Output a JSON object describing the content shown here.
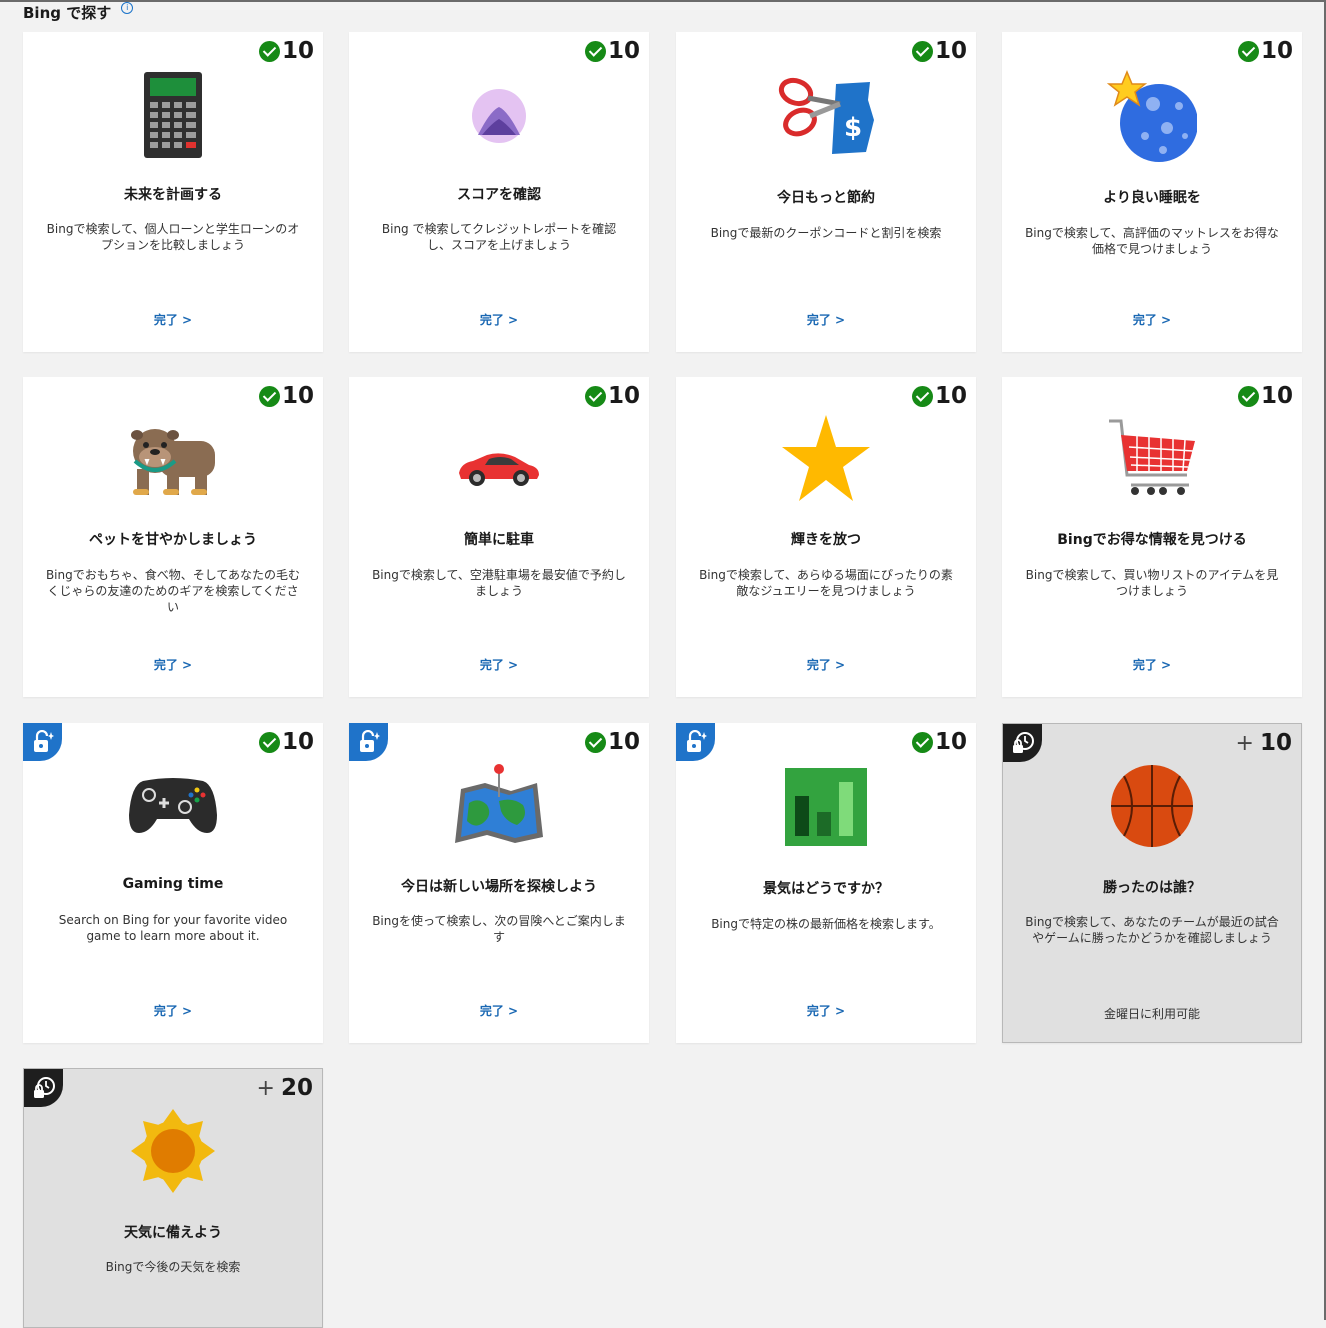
{
  "section": {
    "title": "Bing で探す",
    "info": "i"
  },
  "cards": [
    {
      "title": "未来を計画する",
      "desc": "Bingで検索して、個人ローンと学生ローンのオプションを比較しましょう",
      "points": "10",
      "link": "完了 >"
    },
    {
      "title": "スコアを確認",
      "desc": "Bing で検索してクレジットレポートを確認し、スコアを上げましょう",
      "points": "10",
      "link": "完了 >"
    },
    {
      "title": "今日もっと節約",
      "desc": "Bingで最新のクーポンコードと割引を検索",
      "points": "10",
      "link": "完了 >"
    },
    {
      "title": "より良い睡眠を",
      "desc": "Bingで検索して、高評価のマットレスをお得な価格で見つけましょう",
      "points": "10",
      "link": "完了 >"
    },
    {
      "title": "ペットを甘やかしましょう",
      "desc": "Bingでおもちゃ、食べ物、そしてあなたの毛むくじゃらの友達のためのギアを検索してください",
      "points": "10",
      "link": "完了 >"
    },
    {
      "title": "簡単に駐車",
      "desc": "Bingで検索して、空港駐車場を最安値で予約しましょう",
      "points": "10",
      "link": "完了 >"
    },
    {
      "title": "輝きを放つ",
      "desc": "Bingで検索して、あらゆる場面にぴったりの素敵なジュエリーを見つけましょう",
      "points": "10",
      "link": "完了 >"
    },
    {
      "title": "Bingでお得な情報を見つける",
      "desc": "Bingで検索して、買い物リストのアイテムを見つけましょう",
      "points": "10",
      "link": "完了 >"
    },
    {
      "title": "Gaming time",
      "desc": "Search on Bing for your favorite video game to learn more about it.",
      "points": "10",
      "link": "完了 >"
    },
    {
      "title": "今日は新しい場所を探検しよう",
      "desc": "Bingを使って検索し、次の冒険へとご案内します",
      "points": "10",
      "link": "完了 >"
    },
    {
      "title": "景気はどうですか？",
      "desc": "Bingで特定の株の最新価格を検索します。",
      "points": "10",
      "link": "完了 >"
    },
    {
      "title": "勝ったのは誰？",
      "desc": "Bingで検索して、あなたのチームが最近の試合やゲームに勝ったかどうかを確認しましょう",
      "points": "10",
      "plus": "+",
      "availability": "金曜日に利用可能"
    },
    {
      "title": "天気に備えよう",
      "desc": "Bingで今後の天気を検索",
      "points": "20",
      "plus": "+"
    }
  ],
  "icons": [
    "calculator-icon",
    "mountain-icon",
    "scissors-coupon-icon",
    "moon-star-icon",
    "bulldog-icon",
    "car-icon",
    "star-icon",
    "shopping-cart-icon",
    "game-controller-icon",
    "map-icon",
    "stock-chart-icon",
    "basketball-icon",
    "sun-icon"
  ],
  "colors": {
    "check": "#168a16",
    "link": "#1a68b3",
    "badge_blue": "#1f73c9",
    "locked_bg": "#e0e0e0"
  }
}
